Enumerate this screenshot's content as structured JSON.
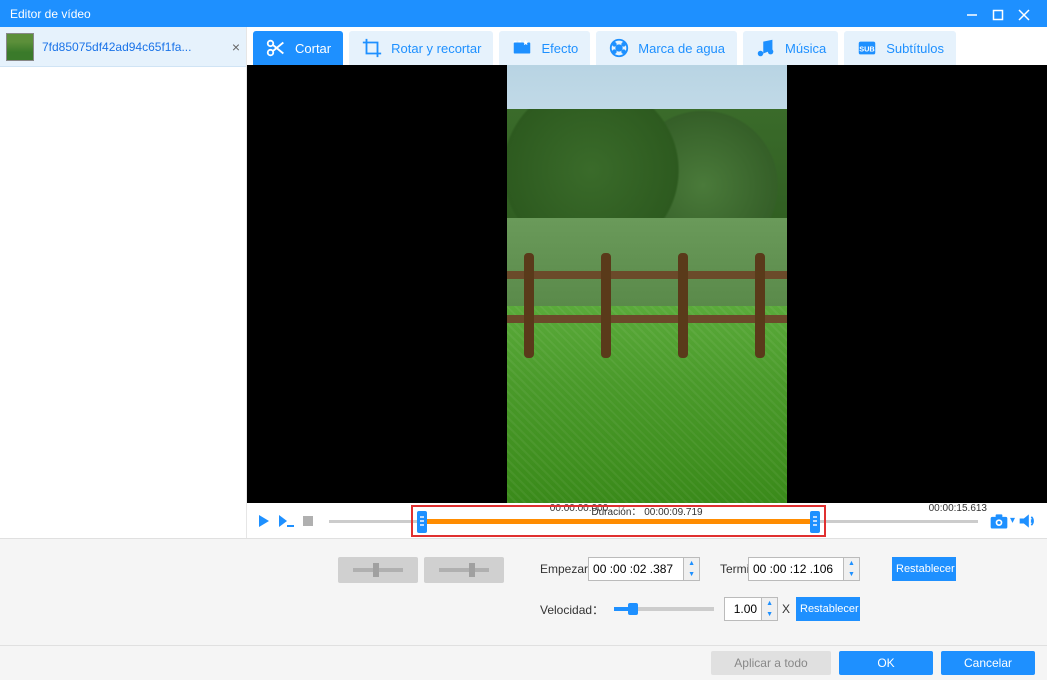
{
  "window": {
    "title": "Editor de vídeo"
  },
  "sidebar": {
    "items": [
      {
        "name": "7fd85075df42ad94c65f1fa..."
      }
    ]
  },
  "tabs": [
    {
      "id": "cut",
      "label": "Cortar",
      "active": true
    },
    {
      "id": "rotate",
      "label": "Rotar y recortar",
      "active": false
    },
    {
      "id": "effect",
      "label": "Efecto",
      "active": false
    },
    {
      "id": "watermark",
      "label": "Marca de agua",
      "active": false
    },
    {
      "id": "music",
      "label": "Música",
      "active": false
    },
    {
      "id": "subtitles",
      "label": "Subtítulos",
      "active": false
    }
  ],
  "timeline": {
    "start": "00:00:00.000",
    "end": "00:00:15.613",
    "duration_label": "Duración：",
    "duration_value": "00:00:09.719"
  },
  "cut": {
    "start_label": "Empezar",
    "start_value": "00 :00 :02 .387",
    "end_label": "Terminar",
    "end_value": "00 :00 :12 .106",
    "speed_label": "Velocidad：",
    "speed_value": "1.00",
    "speed_suffix": "X",
    "reset_label": "Restablecer"
  },
  "footer": {
    "apply_all": "Aplicar a todo",
    "ok": "OK",
    "cancel": "Cancelar"
  }
}
